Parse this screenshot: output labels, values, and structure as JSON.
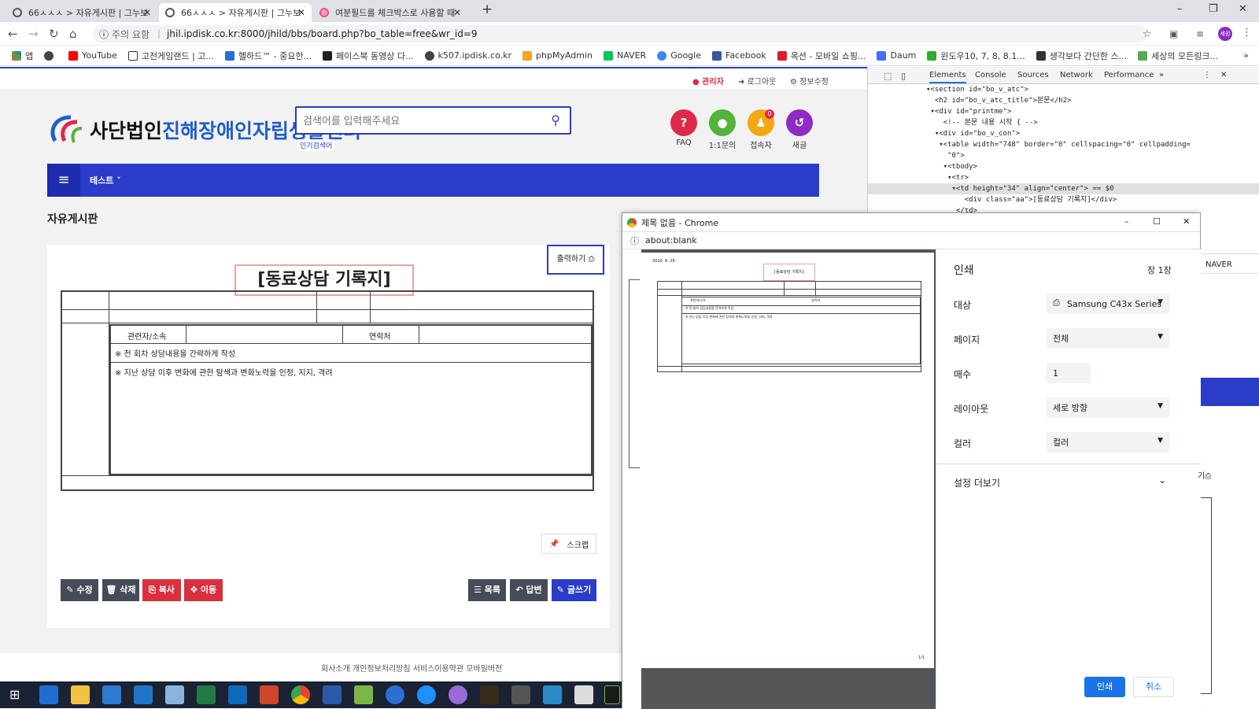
{
  "browser": {
    "tabs": [
      {
        "title": "66ㅅㅅㅅ > 자유게시판 | 그누보",
        "active": false
      },
      {
        "title": "66ㅅㅅㅅ > 자유게시판 | 그누보",
        "active": true
      },
      {
        "title": "여분필드를 체크박스로 사용할 때",
        "active": false
      }
    ],
    "new_tab": "+",
    "window_controls": [
      "–",
      "❐",
      "✕"
    ],
    "security_label": "주의 요함",
    "url": "jhil.ipdisk.co.kr:8000/jhild/bbs/board.php?bo_table=free&wr_id=9",
    "profile_initial": "세원",
    "bookmarks": [
      "앱",
      "",
      "YouTube",
      "고전게임랜드 | 고...",
      "헬하드™ - 중요한...",
      "페이스북 동영상 다...",
      "k507.ipdisk.co.kr",
      "phpMyAdmin",
      "NAVER",
      "Google",
      "Facebook",
      "옥션 - 모바일 쇼핑...",
      "Daum",
      "윈도우10, 7, 8, 8.1...",
      "생각보다 간단한 스...",
      "세상의 모든링크..."
    ],
    "bookmarks_more": "»"
  },
  "site": {
    "top_links": [
      "관리자",
      "로그아웃",
      "정보수정"
    ],
    "logo_prefix": "사단법인",
    "logo_name": "진해장애인자립생활센터",
    "search_placeholder": "검색어를 입력해주세요",
    "popular_keywords": "인기검색어",
    "quick_icons": [
      {
        "label": "FAQ",
        "glyph": "?",
        "color": "#e0294a"
      },
      {
        "label": "1:1문의",
        "glyph": "●",
        "color": "#52b43a"
      },
      {
        "label": "접속자",
        "glyph": "♟",
        "color": "#f5a712",
        "badge": "0"
      },
      {
        "label": "새글",
        "glyph": "↺",
        "color": "#8e2bc6"
      }
    ],
    "nav_menu": "테스트 ˅",
    "board_title": "자유게시판",
    "print_button": "출력하기",
    "form_title": "[동료상담 기록지]",
    "form": {
      "relation_label": "관련자/소속",
      "contact_label": "연락처",
      "note1": "※ 전 회차 상담내용을 간략하게 작성",
      "note2": "※ 지난 상담 이후 변화에 관한 탐색과 변화노력을 인정, 지지, 격려"
    },
    "scrap_button": "스크랩",
    "buttons_left": [
      "수정",
      "삭제",
      "복사",
      "이동"
    ],
    "buttons_right": [
      "목록",
      "답변",
      "글쓰기"
    ],
    "footer_links": "회사소개    개인정보처리방침    서비스이용약관    모바일버전"
  },
  "devtools": {
    "tabs": [
      "Elements",
      "Console",
      "Sources",
      "Network",
      "Performance",
      "»"
    ],
    "lines": [
      "▾<section id=\"bo_v_atc\">",
      "  <h2 id=\"bo_v_atc_title\">본문</h2>",
      " ▾<div id=\"printme\">",
      "    <!-- 본문 내용 시작 { -->",
      "  ▾<div id=\"bo_v_con\">",
      "   ▾<table width=\"748\" border=\"0\" cellspacing=\"0\" cellpadding=",
      "     \"0\">",
      "    ▾<tbody>",
      "     ▾<tr>",
      "      ▾<td height=\"34\" align=\"center\"> == $0",
      "         <div class=\"aa\">[동료상담 기록지]</div>",
      "       </td>"
    ],
    "selected_line": 9
  },
  "print_dialog": {
    "window_title": "제목 없음 - Chrome",
    "url": "about:blank",
    "preview_date": "2020. 4. 26.",
    "preview_title": "[동료상담 기록지]",
    "preview_page": "1/1",
    "heading": "인쇄",
    "page_count": "장 1장",
    "settings": [
      {
        "label": "대상",
        "value": "Samsung C43x Series"
      },
      {
        "label": "페이지",
        "value": "전체"
      },
      {
        "label": "매수",
        "value": "1"
      },
      {
        "label": "레이아웃",
        "value": "세로 방향"
      },
      {
        "label": "컬러",
        "value": "컬러"
      }
    ],
    "more_settings": "설정 더보기",
    "print_button": "인쇄",
    "cancel_button": "취소"
  },
  "right_sliver": {
    "naver_label": "NAVER",
    "print_fragment": "기"
  }
}
